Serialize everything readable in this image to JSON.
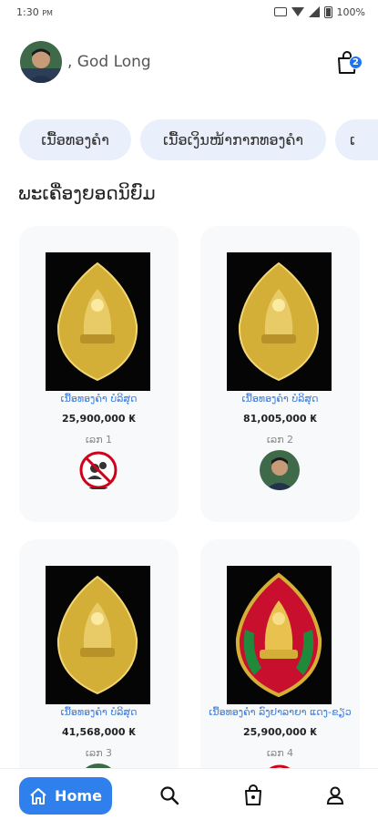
{
  "status_bar": {
    "time": "1:30",
    "time_suffix": "PM",
    "battery": "100%"
  },
  "header": {
    "greeting": ", God Long",
    "cart_count": "2"
  },
  "categories": [
    "ເນື້ອທອງຄໍາ",
    "ເນື້ອເງິນໜ້າກາກທອງຄໍາ",
    "ເ"
  ],
  "section_title": "ພະເຄື່ອງຍອດນິຍົມ",
  "products": [
    {
      "name": "ເນື້ອທອງຄໍາ ບໍລິສຸດ",
      "price": "25,900,000 ₭",
      "rank": "ເລກ 1",
      "seller": "no-seller-icon",
      "accent": "#d4af37"
    },
    {
      "name": "ເນື້ອທອງຄໍາ ບໍລິສຸດ",
      "price": "81,005,000 ₭",
      "rank": "ເລກ 2",
      "seller": "avatar",
      "accent": "#d4af37"
    },
    {
      "name": "ເນື້ອທອງຄໍາ ບໍລິສຸດ",
      "price": "41,568,000 ₭",
      "rank": "ເລກ 3",
      "seller": "avatar",
      "accent": "#d4af37"
    },
    {
      "name": "ເນື້ອທອງຄໍາ ລົງຢາລາຍາ ແດງ-ຂຽວ",
      "price": "25,900,000 ₭",
      "rank": "ເລກ 4",
      "seller": "no-seller-icon",
      "accent": "#c8102e"
    }
  ],
  "nav": {
    "home_label": "Home"
  },
  "colors": {
    "accent": "#2f80ed",
    "chip_bg": "#eaf0fb",
    "link": "#3b7bd9"
  }
}
